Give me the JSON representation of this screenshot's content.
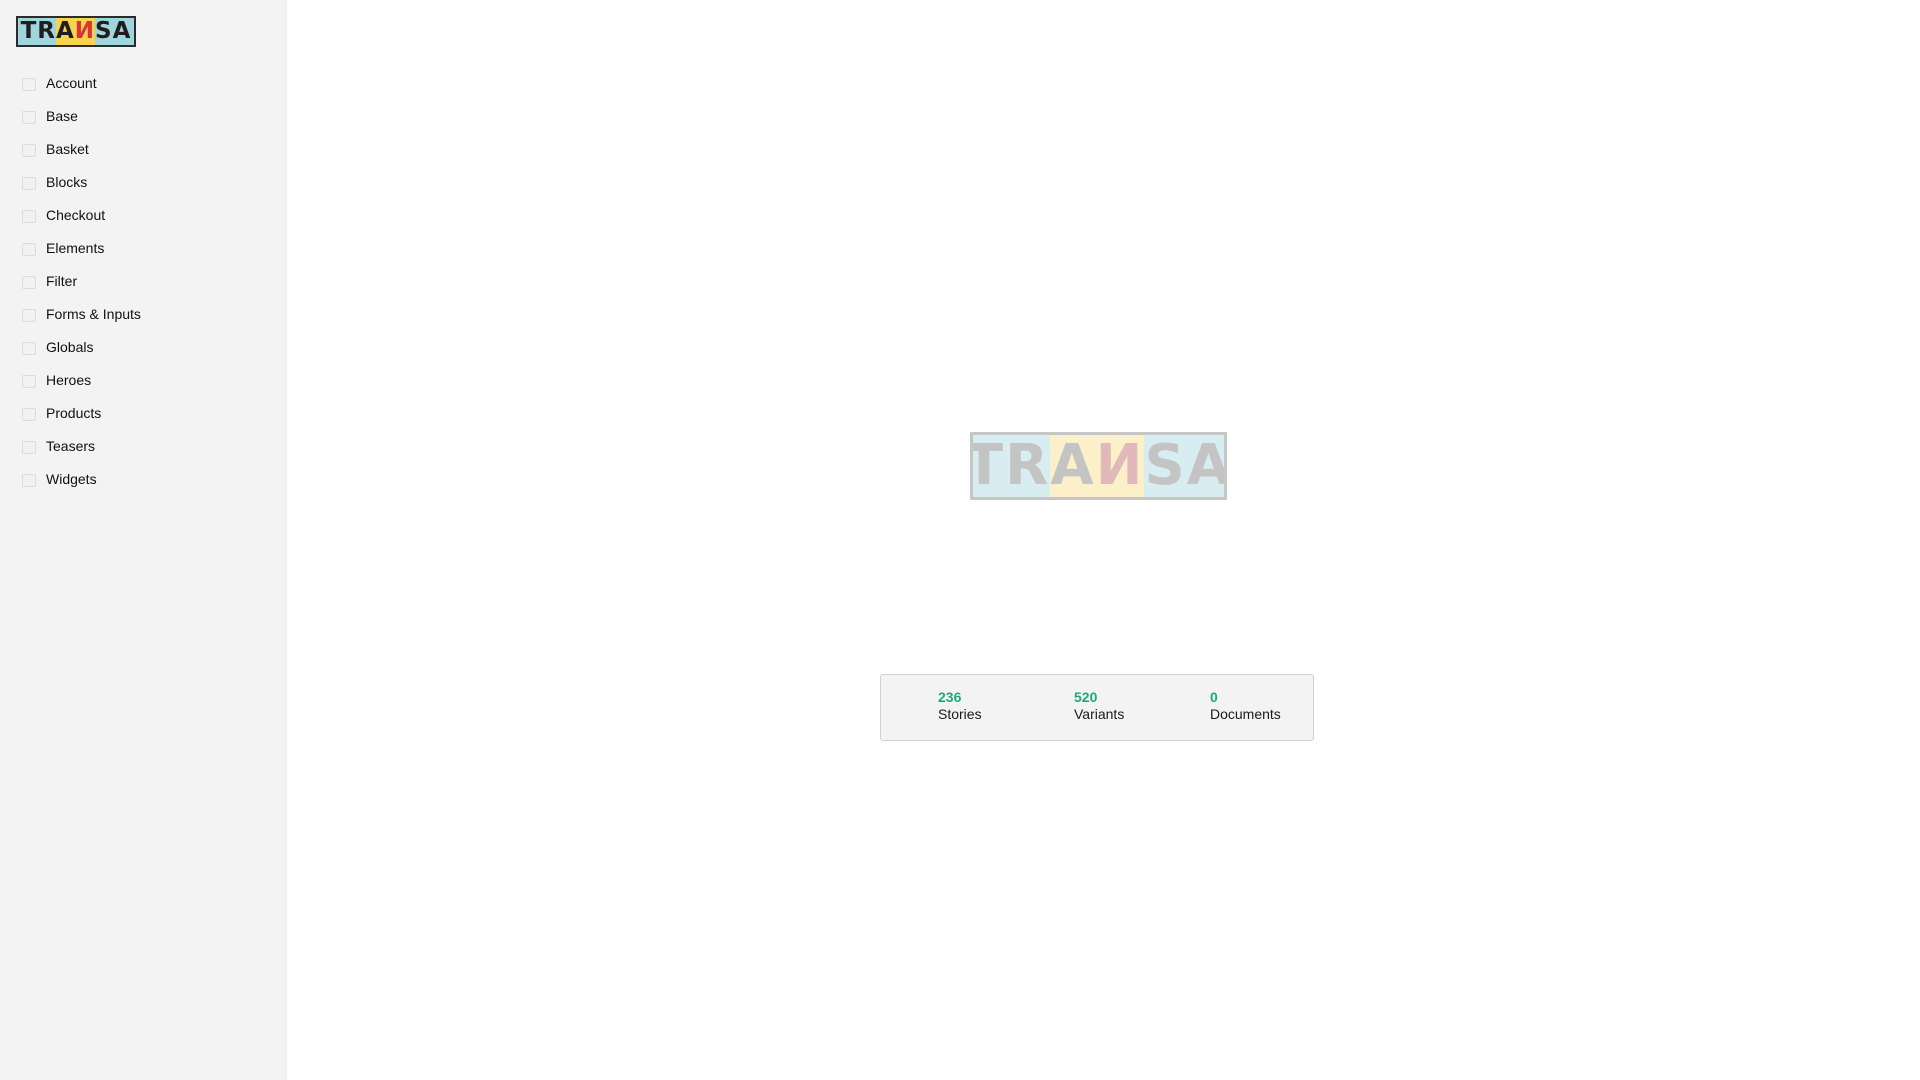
{
  "brand": {
    "logo_letters": [
      "T",
      "R",
      "A",
      "И",
      "S",
      "A"
    ],
    "logo_colors": {
      "background": "#9fd5dc",
      "highlight": "#f7d44c",
      "accent": "#d8343b",
      "ink": "#1e1e1e"
    }
  },
  "sidebar": {
    "items": [
      {
        "label": "Account",
        "icon": "folder-icon"
      },
      {
        "label": "Base",
        "icon": "folder-icon"
      },
      {
        "label": "Basket",
        "icon": "folder-icon"
      },
      {
        "label": "Blocks",
        "icon": "folder-icon"
      },
      {
        "label": "Checkout",
        "icon": "folder-icon"
      },
      {
        "label": "Elements",
        "icon": "folder-icon"
      },
      {
        "label": "Filter",
        "icon": "folder-icon"
      },
      {
        "label": "Forms & Inputs",
        "icon": "folder-icon"
      },
      {
        "label": "Globals",
        "icon": "folder-icon"
      },
      {
        "label": "Heroes",
        "icon": "folder-icon"
      },
      {
        "label": "Products",
        "icon": "folder-icon"
      },
      {
        "label": "Teasers",
        "icon": "folder-icon"
      },
      {
        "label": "Widgets",
        "icon": "folder-icon"
      }
    ]
  },
  "stats": [
    {
      "value": "236",
      "label": "Stories"
    },
    {
      "value": "520",
      "label": "Variants"
    },
    {
      "value": "0",
      "label": "Documents"
    }
  ],
  "colors": {
    "stat_value": "#1ea97c",
    "sidebar_bg": "#f3f3f3"
  }
}
